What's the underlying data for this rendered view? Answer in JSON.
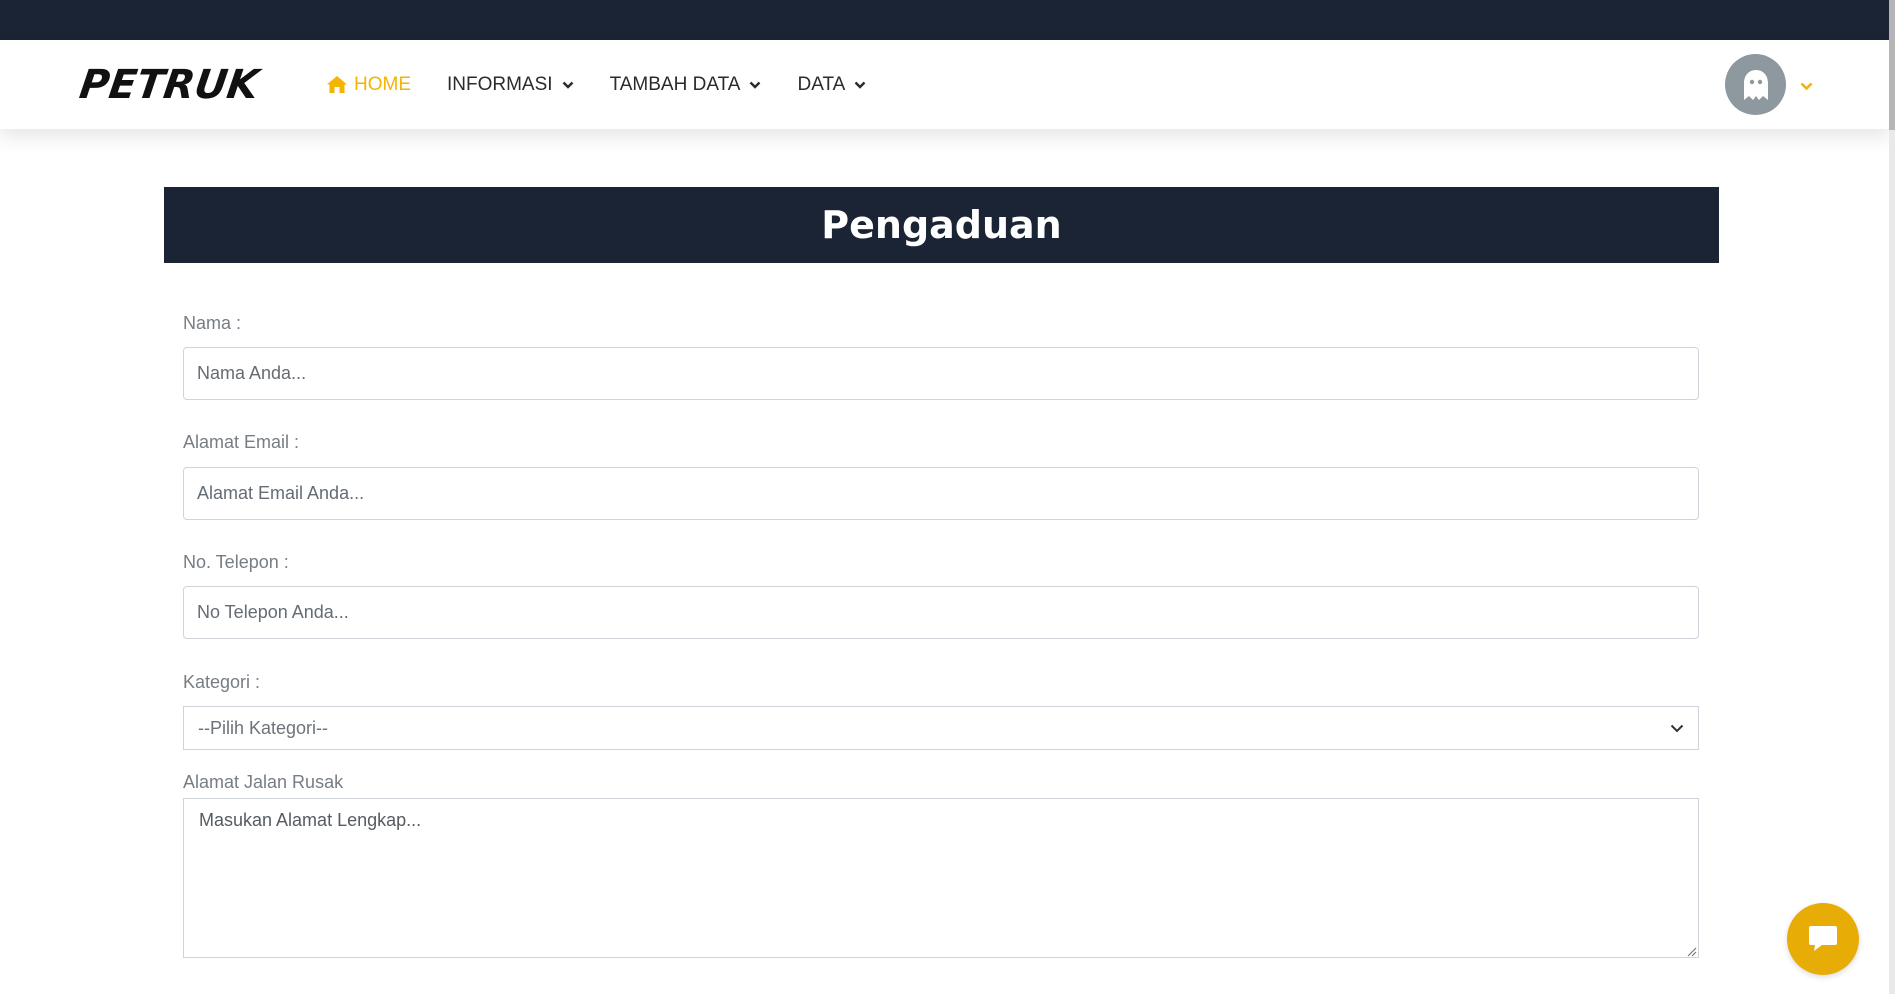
{
  "brand": {
    "logo_text": "PETRUK"
  },
  "nav": {
    "items": [
      {
        "label": "HOME",
        "active": true,
        "icon": "home-icon"
      },
      {
        "label": "INFORMASI",
        "dropdown": true
      },
      {
        "label": "TAMBAH DATA",
        "dropdown": true
      },
      {
        "label": "DATA",
        "dropdown": true
      }
    ]
  },
  "user_menu": {
    "avatar_icon": "ghost-icon",
    "chevron": "chevron-down-icon"
  },
  "form": {
    "title": "Pengaduan",
    "fields": {
      "nama": {
        "label": "Nama :",
        "placeholder": "Nama Anda..."
      },
      "email": {
        "label": "Alamat Email :",
        "placeholder": "Alamat Email Anda..."
      },
      "telepon": {
        "label": "No. Telepon :",
        "placeholder": "No Telepon Anda..."
      },
      "kategori": {
        "label": "Kategori :",
        "selected": "--Pilih Kategori--"
      },
      "alamat": {
        "label": "Alamat Jalan Rusak",
        "placeholder": "Masukan Alamat Lengkap..."
      }
    }
  },
  "chat_button": {
    "icon": "chat-icon"
  },
  "colors": {
    "primary_dark": "#1b2435",
    "accent": "#f4b400",
    "chat_fab": "#e8ac06",
    "avatar_bg": "#8d989f"
  }
}
